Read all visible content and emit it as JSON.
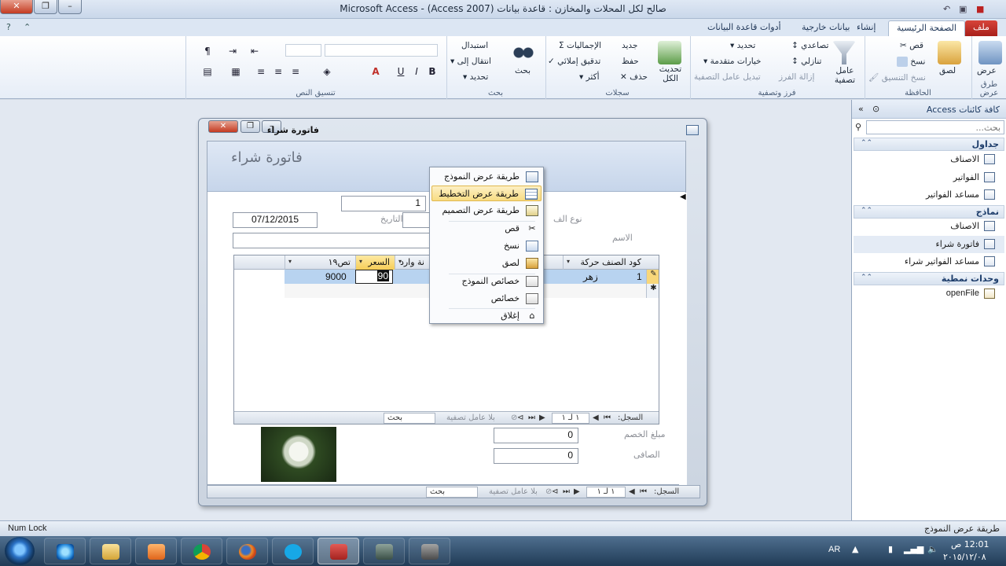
{
  "window": {
    "title": "صالح لكل المحلات والمخازن : قاعدة بيانات (Access 2007) - Microsoft Access"
  },
  "ribbon_tabs": [
    {
      "label": "ملف"
    },
    {
      "label": "الصفحة الرئيسية"
    },
    {
      "label": "إنشاء"
    },
    {
      "label": "بيانات خارجية"
    },
    {
      "label": "أدوات قاعدة البيانات"
    }
  ],
  "ribbon": {
    "views": {
      "view_label": "عرض",
      "group": "طرق عرض"
    },
    "clipboard": {
      "paste": "لصق",
      "cut": "قص",
      "copy": "نسخ",
      "format_painter": "نسخ التنسيق",
      "group": "الحافظة"
    },
    "sort_filter": {
      "filter": "عامل تصفية",
      "ascending": "تصاعدي",
      "descending": "تنازلي",
      "remove_sort": "إزالة الفرز",
      "selection": "تحديد",
      "advanced": "خيارات متقدمة",
      "toggle_filter": "تبديل عامل التصفية",
      "group": "فرز وتصفية"
    },
    "records": {
      "refresh": "تحديث الكل",
      "new": "جديد",
      "save": "حفظ",
      "delete": "حذف",
      "totals": "الإجماليات",
      "spelling": "تدقيق إملائي",
      "more": "أكثر",
      "group": "سجلات"
    },
    "find": {
      "find": "بحث",
      "replace": "استبدال",
      "goto": "انتقال إلى",
      "select": "تحديد",
      "group": "بحث"
    },
    "text_format": {
      "bold": "B",
      "italic": "I",
      "underline": "U",
      "font_color": "A",
      "group": "تنسيق النص"
    }
  },
  "nav_pane": {
    "title": "كافة كائنات Access",
    "search_placeholder": "بحث...",
    "groups": [
      {
        "name": "جداول",
        "items": [
          "الاصناف",
          "الفواتير",
          "مساعد الفواتير"
        ]
      },
      {
        "name": "نماذج",
        "items": [
          "الاصناف",
          "فاتورة شراء",
          "مساعد الفواتير شراء"
        ]
      },
      {
        "name": "وحدات نمطية",
        "items": [
          "openFile"
        ]
      }
    ]
  },
  "form": {
    "window_title": "فاتورة شراء",
    "header_title": "فاتورة شراء",
    "invoice_no": "1",
    "date_value": "07/12/2015",
    "date_label": "التاريخ",
    "type_label": "نوع الف",
    "name_label": "الاسم",
    "discount_label": "مبلغ الخصم",
    "discount_value": "0",
    "net_label": "الصافى",
    "net_value": "0",
    "subform": {
      "columns": [
        "كود الصنف",
        "حركة",
        "نة وارد",
        "السعر",
        "تص١٩"
      ],
      "row": {
        "selector": "1",
        "item": "زهر",
        "price": "90",
        "total": "9000"
      },
      "nav": {
        "record_label": "السجل:",
        "position": "١ لـ ١",
        "filter": "بلا عامل تصفية",
        "search": "بحث"
      }
    },
    "nav": {
      "record_label": "السجل:",
      "position": "١ لـ ١",
      "filter": "بلا عامل تصفية",
      "search": "بحث"
    }
  },
  "context_menu": {
    "items": [
      "طريقة عرض النموذج",
      "طريقة عرض التخطيط",
      "طريقة عرض التصميم",
      "قص",
      "نسخ",
      "لصق",
      "خصائص النموذج",
      "خصائص",
      "إغلاق"
    ]
  },
  "status": {
    "left": "Num Lock",
    "right": "طريقة عرض النموذج"
  },
  "taskbar": {
    "lang": "AR",
    "time": "12:01 ص",
    "date": "٢٠١٥/١٢/٠٨"
  },
  "colors": {
    "file_tab": "#c0302a",
    "highlight": "#f8dc83",
    "ribbon_bg": "#e6edf7"
  }
}
